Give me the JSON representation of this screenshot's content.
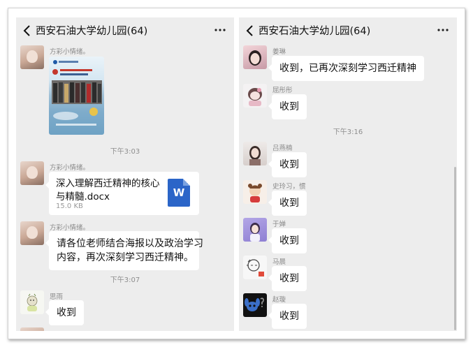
{
  "left": {
    "header": {
      "title": "西安石油大学幼儿园(64)"
    },
    "messages": {
      "m1": {
        "sender": "方彩小情绪。"
      },
      "t1": "下午3:03",
      "m2": {
        "sender": "方彩小情绪。",
        "file_name": "深入理解西迁精神的核心与精髓.docx",
        "file_size": "15.0 KB",
        "file_icon_letter": "W"
      },
      "m3": {
        "sender": "方彩小情绪。",
        "line1": "请各位老师结合海报以及政治学习",
        "line2": "内容，再次深刻学习西迁精神。"
      },
      "t2": "下午3:07",
      "m4": {
        "sender": "思雨",
        "text": "收到"
      }
    }
  },
  "right": {
    "header": {
      "title": "西安石油大学幼儿园(64)"
    },
    "messages": {
      "r1": {
        "sender": "姜琳",
        "text": "收到，已再次深刻学习西迁精神"
      },
      "r2": {
        "sender": "屈彤彤",
        "text": "收到"
      },
      "t1": "下午3:16",
      "r3": {
        "sender": "吕燕楠",
        "text": "收到"
      },
      "r4": {
        "sender": "史玲习，惯",
        "text": "收到"
      },
      "r5": {
        "sender": "于婵",
        "text": "收到"
      },
      "r6": {
        "sender": "马晨",
        "text": "收到"
      },
      "r7": {
        "sender": "赵璇",
        "text": "收到"
      }
    }
  },
  "icons": {
    "back": "chevron-left-icon",
    "more": "more-dots-icon",
    "file": "word-document-icon"
  },
  "colors": {
    "chat_bg": "#ededed",
    "bubble": "#ffffff",
    "word_blue": "#2b65c8"
  }
}
